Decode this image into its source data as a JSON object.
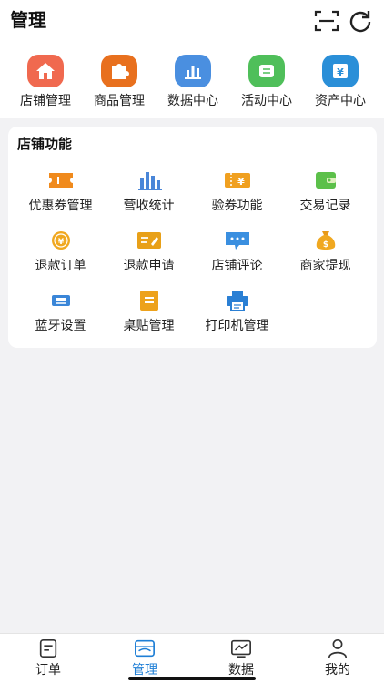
{
  "header": {
    "title": "管理",
    "scan_icon": "scan-icon",
    "refresh_icon": "refresh-icon"
  },
  "quick_links": [
    {
      "label": "店铺管理",
      "icon": "store-home-icon",
      "color": "#f0694f"
    },
    {
      "label": "商品管理",
      "icon": "puzzle-icon",
      "color": "#e8701e"
    },
    {
      "label": "数据中心",
      "icon": "bar-chart-icon",
      "color": "#4a8fe0"
    },
    {
      "label": "活动中心",
      "icon": "activity-icon",
      "color": "#4fbf5a"
    },
    {
      "label": "资产中心",
      "icon": "yen-box-icon",
      "color": "#2a8fd8"
    }
  ],
  "store_functions": {
    "title": "店铺功能",
    "items": [
      {
        "label": "优惠券管理",
        "icon": "coupon-icon"
      },
      {
        "label": "营收统计",
        "icon": "revenue-chart-icon"
      },
      {
        "label": "验券功能",
        "icon": "ticket-verify-icon"
      },
      {
        "label": "交易记录",
        "icon": "wallet-icon"
      },
      {
        "label": "退款订单",
        "icon": "refund-coin-icon"
      },
      {
        "label": "退款申请",
        "icon": "refund-apply-icon"
      },
      {
        "label": "店铺评论",
        "icon": "comment-icon"
      },
      {
        "label": "商家提现",
        "icon": "money-bag-icon"
      },
      {
        "label": "蓝牙设置",
        "icon": "bluetooth-printer-icon"
      },
      {
        "label": "桌贴管理",
        "icon": "table-sticker-icon"
      },
      {
        "label": "打印机管理",
        "icon": "printer-icon"
      }
    ]
  },
  "tabbar": {
    "active": "管理",
    "tabs": [
      {
        "label": "订单",
        "icon": "order-icon"
      },
      {
        "label": "管理",
        "icon": "manage-icon"
      },
      {
        "label": "数据",
        "icon": "data-icon"
      },
      {
        "label": "我的",
        "icon": "profile-icon"
      }
    ]
  },
  "colors": {
    "accent": "#1f7fd6",
    "background": "#f2f2f4"
  }
}
